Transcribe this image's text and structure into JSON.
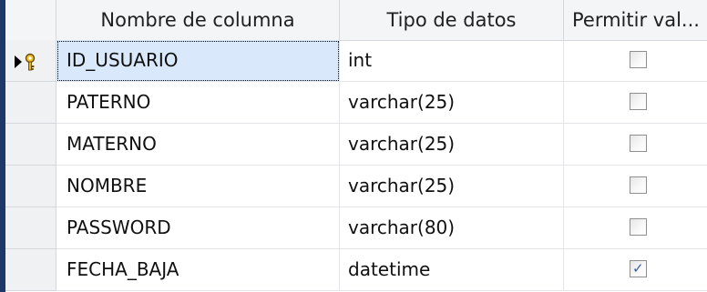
{
  "headers": {
    "name": "Nombre de columna",
    "type": "Tipo de datos",
    "allow_null": "Permitir val..."
  },
  "columns": [
    {
      "name": "ID_USUARIO",
      "type": "int",
      "allow_null": false,
      "primary_key": true,
      "current": true
    },
    {
      "name": "PATERNO",
      "type": "varchar(25)",
      "allow_null": false
    },
    {
      "name": "MATERNO",
      "type": "varchar(25)",
      "allow_null": false
    },
    {
      "name": "NOMBRE",
      "type": "varchar(25)",
      "allow_null": false
    },
    {
      "name": "PASSWORD",
      "type": "varchar(80)",
      "allow_null": false
    },
    {
      "name": "FECHA_BAJA",
      "type": "datetime",
      "allow_null": true
    }
  ],
  "icons": {
    "current_row": "row-pointer-icon",
    "primary_key": "key-icon",
    "check": "checkmark-icon"
  },
  "colors": {
    "left_strip": "#1e3766",
    "active_cell": "#d9e9fb",
    "key": "#e0b020"
  }
}
